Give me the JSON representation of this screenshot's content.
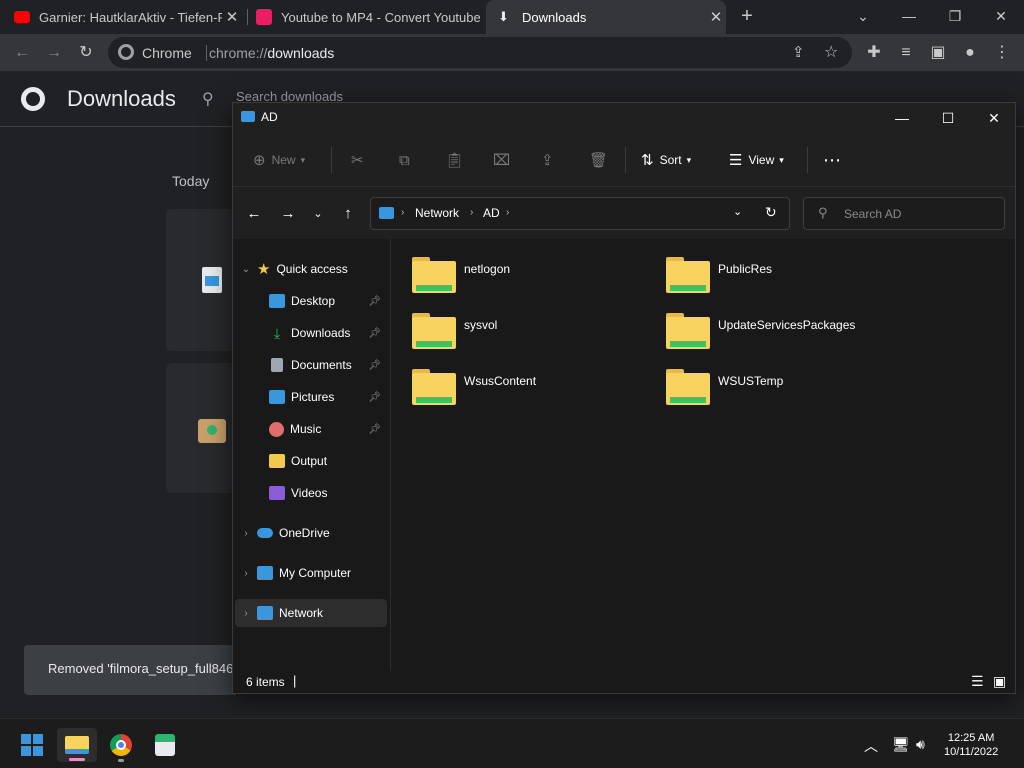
{
  "browser": {
    "tabs": [
      {
        "title": "Garnier: HautklarAktiv - Tiefen-Reinigung",
        "favicon_color": "#ff0000",
        "active": false
      },
      {
        "title": "Youtube to MP4 - Convert Youtube",
        "favicon_color": "#e91e63",
        "active": false
      },
      {
        "title": "Downloads",
        "favicon_color": "#c8c9cb",
        "active": true
      }
    ],
    "omnibox": {
      "site_label": "Chrome",
      "url_scheme": "chrome://",
      "url_path": "downloads"
    }
  },
  "downloads_page": {
    "title": "Downloads",
    "search_placeholder": "Search downloads",
    "section_label": "Today",
    "toast_text": "Removed 'filmora_setup_full846"
  },
  "explorer": {
    "title": "AD",
    "commands": {
      "new": "New",
      "sort": "Sort",
      "view": "View"
    },
    "breadcrumb": [
      "Network",
      "AD"
    ],
    "search_placeholder": "Search AD",
    "sidebar": {
      "quick_access": "Quick access",
      "items": [
        {
          "label": "Desktop",
          "pinned": true,
          "icon": "desktop-icon",
          "color": "#3a96dd"
        },
        {
          "label": "Downloads",
          "pinned": true,
          "icon": "download-arrow-icon",
          "color": "#2fb36d"
        },
        {
          "label": "Documents",
          "pinned": true,
          "icon": "document-icon",
          "color": "#a0a7b4"
        },
        {
          "label": "Pictures",
          "pinned": true,
          "icon": "pictures-icon",
          "color": "#3a96dd"
        },
        {
          "label": "Music",
          "pinned": true,
          "icon": "music-icon",
          "color": "#e06c6c"
        },
        {
          "label": "Output",
          "pinned": false,
          "icon": "folder-icon",
          "color": "#f2c94c"
        },
        {
          "label": "Videos",
          "pinned": false,
          "icon": "videos-icon",
          "color": "#8a5cd6"
        }
      ],
      "onedrive": "OneDrive",
      "my_computer": "My Computer",
      "network": "Network"
    },
    "folders": [
      "netlogon",
      "PublicRes",
      "sysvol",
      "UpdateServicesPackages",
      "WsusContent",
      "WSUSTemp"
    ],
    "status": "6 items"
  },
  "taskbar": {
    "time": "12:25 AM",
    "date": "10/11/2022"
  },
  "colors": {
    "folder_yellow": "#f7d360",
    "folder_green": "#3cc35a",
    "accent_blue": "#3a96dd"
  }
}
